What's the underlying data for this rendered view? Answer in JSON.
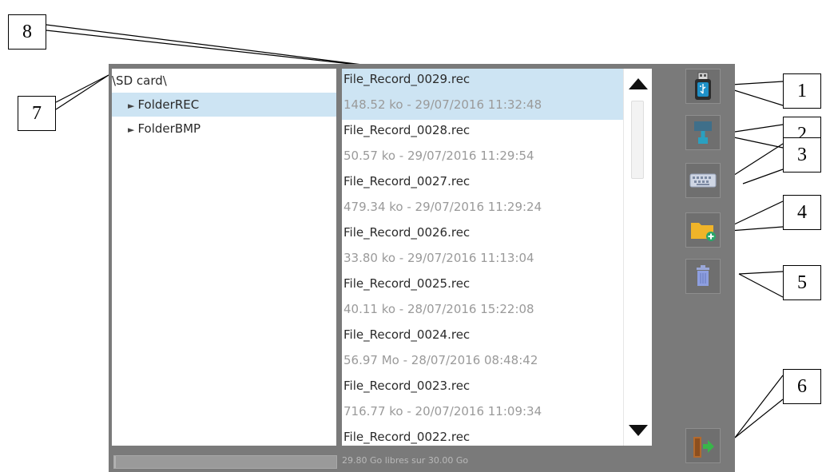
{
  "tree": {
    "root": "\\SD card\\",
    "folders": [
      {
        "label": "FolderREC",
        "selected": true
      },
      {
        "label": "FolderBMP",
        "selected": false
      }
    ]
  },
  "files": [
    {
      "name": "File_Record_0029.rec",
      "meta": "148.52 ko - 29/07/2016 11:32:48",
      "selected": true
    },
    {
      "name": "File_Record_0028.rec",
      "meta": "50.57 ko - 29/07/2016 11:29:54",
      "selected": false
    },
    {
      "name": "File_Record_0027.rec",
      "meta": "479.34 ko - 29/07/2016 11:29:24",
      "selected": false
    },
    {
      "name": "File_Record_0026.rec",
      "meta": "33.80 ko - 29/07/2016 11:13:04",
      "selected": false
    },
    {
      "name": "File_Record_0025.rec",
      "meta": "40.11 ko - 28/07/2016 15:22:08",
      "selected": false
    },
    {
      "name": "File_Record_0024.rec",
      "meta": "56.97 Mo - 28/07/2016 08:48:42",
      "selected": false
    },
    {
      "name": "File_Record_0023.rec",
      "meta": "716.77 ko - 20/07/2016 11:09:34",
      "selected": false
    },
    {
      "name": "File_Record_0022.rec",
      "meta": "",
      "selected": false
    }
  ],
  "sidebar_buttons": [
    {
      "icon": "usb-drive-icon"
    },
    {
      "icon": "usb-transfer-icon"
    },
    {
      "icon": "keyboard-icon"
    },
    {
      "icon": "new-folder-icon"
    },
    {
      "icon": "trash-icon"
    },
    {
      "icon": "exit-door-icon"
    }
  ],
  "status": {
    "free_space": "29.80 Go libres sur 30.00 Go",
    "used_fraction": 0.007
  },
  "callouts": [
    "1",
    "2",
    "3",
    "4",
    "5",
    "6",
    "7",
    "8"
  ],
  "colors": {
    "frame": "#7a7a7a",
    "selection": "#cde4f3",
    "meta_text": "#9a9a9a",
    "folder_yellow": "#f0b429",
    "usb_blue": "#1e90c8"
  }
}
